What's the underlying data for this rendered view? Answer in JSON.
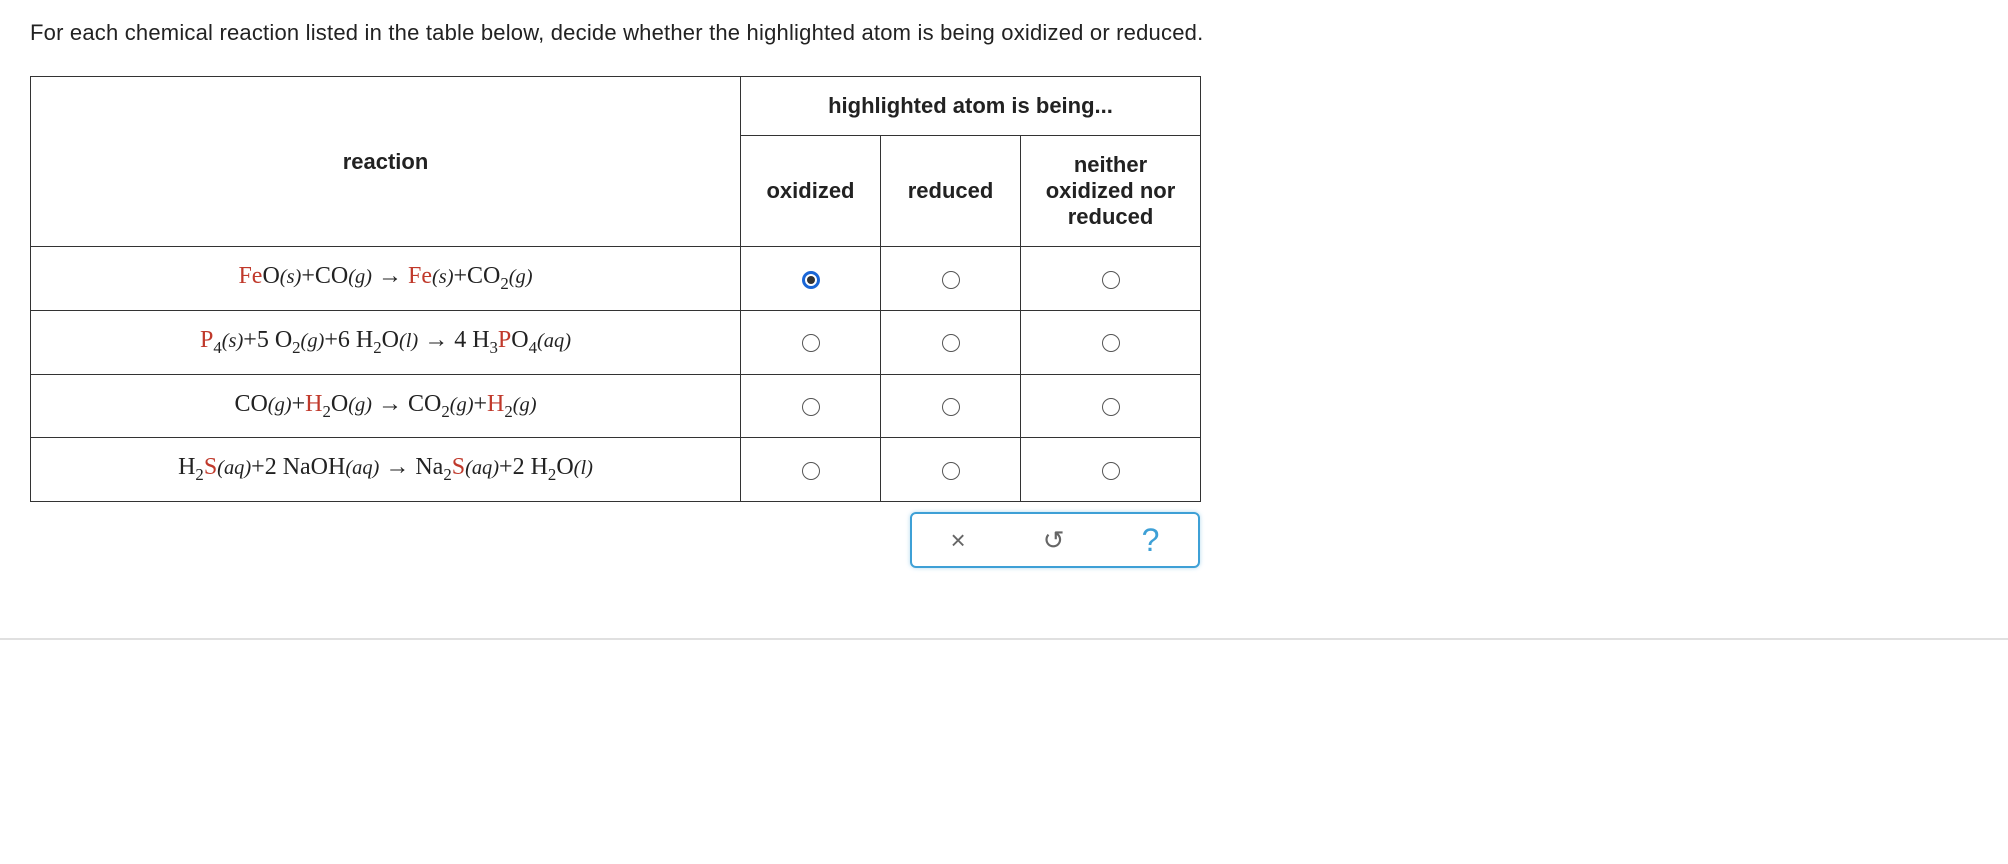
{
  "question": "For each chemical reaction listed in the table below, decide whether the highlighted atom is being oxidized or reduced.",
  "headers": {
    "reaction": "reaction",
    "group": "highlighted atom is being...",
    "oxidized": "oxidized",
    "reduced": "reduced",
    "neither": "neither oxidized nor reduced"
  },
  "rows": [
    {
      "reaction_parts": [
        {
          "text": "Fe",
          "hl": true
        },
        {
          "text": "O",
          "hl": false
        },
        {
          "state": "(s)"
        },
        {
          "text": "+CO"
        },
        {
          "state": "(g)"
        },
        {
          "arrow": true
        },
        {
          "text": "Fe",
          "hl": true
        },
        {
          "state": "(s)"
        },
        {
          "text": "+CO"
        },
        {
          "sub": "2"
        },
        {
          "state": "(g)"
        }
      ],
      "selected": "oxidized"
    },
    {
      "reaction_parts": [
        {
          "text": "P",
          "hl": true
        },
        {
          "sub": "4"
        },
        {
          "state": "(s)"
        },
        {
          "text": "+5 O"
        },
        {
          "sub": "2"
        },
        {
          "state": "(g)"
        },
        {
          "text": "+6 H"
        },
        {
          "sub": "2"
        },
        {
          "text": "O"
        },
        {
          "state": "(l)"
        },
        {
          "arrow": true
        },
        {
          "text": "4 H"
        },
        {
          "sub": "3"
        },
        {
          "text": "P",
          "hl": true
        },
        {
          "text": "O"
        },
        {
          "sub": "4"
        },
        {
          "state": "(aq)"
        }
      ],
      "selected": null
    },
    {
      "reaction_parts": [
        {
          "text": "CO"
        },
        {
          "state": "(g)"
        },
        {
          "text": "+"
        },
        {
          "text": "H",
          "hl": true
        },
        {
          "sub": "2"
        },
        {
          "text": "O"
        },
        {
          "state": "(g)"
        },
        {
          "arrow": true
        },
        {
          "text": "CO"
        },
        {
          "sub": "2"
        },
        {
          "state": "(g)"
        },
        {
          "text": "+"
        },
        {
          "text": "H",
          "hl": true
        },
        {
          "sub": "2"
        },
        {
          "state": "(g)"
        }
      ],
      "selected": null
    },
    {
      "reaction_parts": [
        {
          "text": "H"
        },
        {
          "sub": "2"
        },
        {
          "text": "S",
          "hl": true
        },
        {
          "state": "(aq)"
        },
        {
          "text": "+2 NaOH"
        },
        {
          "state": "(aq)"
        },
        {
          "arrow": true
        },
        {
          "text": "Na"
        },
        {
          "sub": "2"
        },
        {
          "text": "S",
          "hl": true
        },
        {
          "state": "(aq)"
        },
        {
          "text": "+2 H"
        },
        {
          "sub": "2"
        },
        {
          "text": "O"
        },
        {
          "state": "(l)"
        }
      ],
      "selected": null
    }
  ],
  "buttons": {
    "close": "×",
    "reset": "↺",
    "help": "?"
  }
}
